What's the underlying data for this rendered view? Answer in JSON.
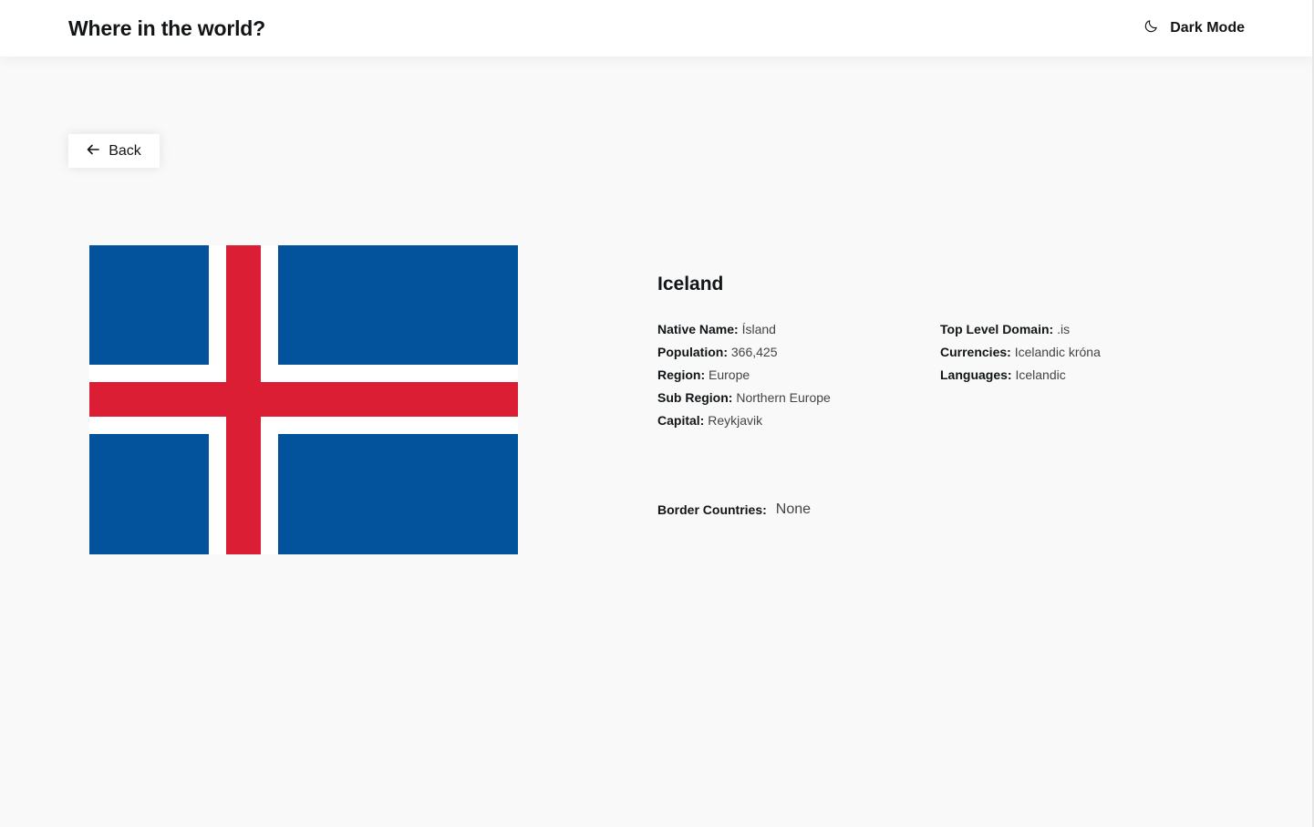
{
  "header": {
    "title": "Where in the world?",
    "mode_label": "Dark Mode",
    "mode_icon": "moon-icon"
  },
  "back": {
    "label": "Back",
    "icon": "arrow-left-icon"
  },
  "flag": {
    "colors": {
      "blue": "#02529c",
      "white": "#ffffff",
      "red": "#dc1e35"
    }
  },
  "country": {
    "name": "Iceland",
    "left": [
      {
        "label": "Native Name:",
        "value": "Ísland"
      },
      {
        "label": "Population:",
        "value": "366,425"
      },
      {
        "label": "Region:",
        "value": "Europe"
      },
      {
        "label": "Sub Region:",
        "value": "Northern Europe"
      },
      {
        "label": "Capital:",
        "value": "Reykjavik"
      }
    ],
    "right": [
      {
        "label": "Top Level Domain:",
        "value": ".is"
      },
      {
        "label": "Currencies:",
        "value": "Icelandic króna"
      },
      {
        "label": "Languages:",
        "value": "Icelandic"
      }
    ],
    "border_label": "Border Countries:",
    "border_value": "None"
  }
}
